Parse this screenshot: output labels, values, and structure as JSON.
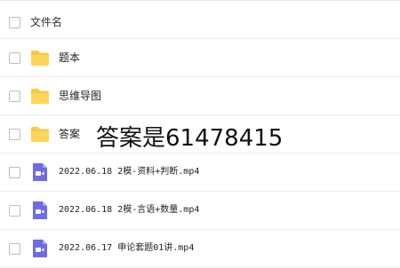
{
  "header": {
    "column_name": "文件名"
  },
  "files": [
    {
      "name": "题本",
      "type": "folder"
    },
    {
      "name": "思维导图",
      "type": "folder"
    },
    {
      "name": "答案",
      "type": "folder"
    },
    {
      "name": "2022.06.18 2模-资料+判断.mp4",
      "type": "video"
    },
    {
      "name": "2022.06.18 2模-言语+数量.mp4",
      "type": "video"
    },
    {
      "name": "2022.06.17 申论套题01讲.mp4",
      "type": "video"
    }
  ],
  "overlay": {
    "text": "答案是61478415"
  },
  "colors": {
    "folder": "#f7c843",
    "video": "#6f6ae8"
  },
  "icons": {
    "folder": "folder-icon",
    "video": "video-file-icon",
    "checkbox": "checkbox-icon"
  }
}
